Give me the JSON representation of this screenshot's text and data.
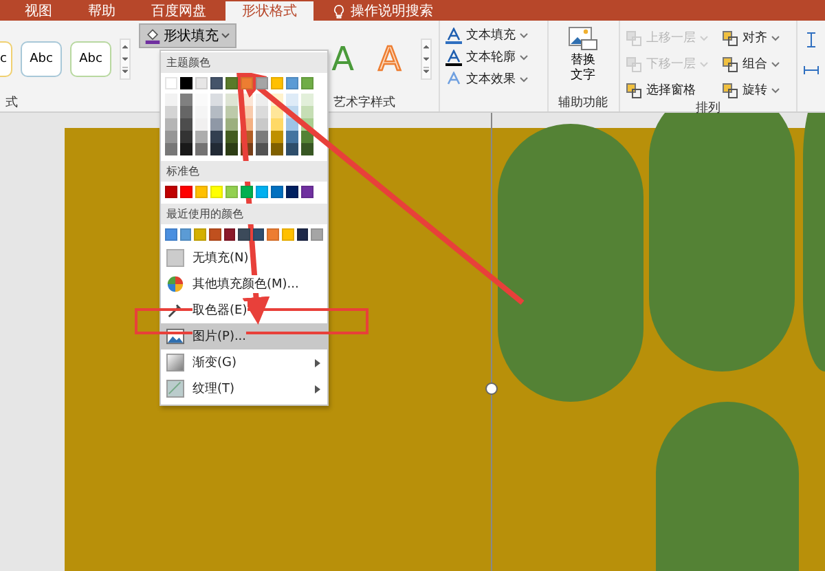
{
  "tabs": [
    {
      "label": "视图",
      "selected": false
    },
    {
      "label": "帮助",
      "selected": false
    },
    {
      "label": "百度网盘",
      "selected": false
    },
    {
      "label": "形状格式",
      "selected": true
    },
    {
      "label": "操作说明搜索",
      "selected": false,
      "kind": "search"
    }
  ],
  "ribbon": {
    "shape_styles": {
      "samples": [
        "c",
        "Abc",
        "Abc"
      ],
      "group_label": "式"
    },
    "shape_fill": {
      "label": "形状填充",
      "expanded": true
    },
    "wordart": {
      "samples": [
        {
          "kind": "green",
          "text": "A"
        },
        {
          "kind": "outline",
          "text": "A"
        }
      ],
      "group_label": "艺术字样式"
    },
    "text_buttons": [
      {
        "kind": "fill",
        "label": "文本填充"
      },
      {
        "kind": "outline",
        "label": "文本轮廓"
      },
      {
        "kind": "effect",
        "label": "文本效果"
      }
    ],
    "alt_text": {
      "label_line1": "替换",
      "label_line2": "文字",
      "group_label": "辅助功能"
    },
    "arrange": {
      "items": [
        {
          "kind": "up",
          "label": "上移一层",
          "disabled": true
        },
        {
          "kind": "align",
          "label": "对齐",
          "disabled": false
        },
        {
          "kind": "down",
          "label": "下移一层",
          "disabled": true
        },
        {
          "kind": "group",
          "label": "组合",
          "disabled": false
        },
        {
          "kind": "pane",
          "label": "选择窗格",
          "disabled": false
        },
        {
          "kind": "rotate",
          "label": "旋转",
          "disabled": false
        }
      ],
      "group_label": "排列"
    }
  },
  "menu": {
    "theme_heading": "主题颜色",
    "theme_colors": [
      {
        "color": "#ffffff"
      },
      {
        "color": "#000000"
      },
      {
        "color": "#e7e6e6"
      },
      {
        "color": "#44546a"
      },
      {
        "color": "#5a7a2a"
      },
      {
        "color": "#ed7d31"
      },
      {
        "color": "#a5a5a5"
      },
      {
        "color": "#ffc000"
      },
      {
        "color": "#5b9bd5"
      },
      {
        "color": "#70ad47"
      }
    ],
    "standard_heading": "标准色",
    "standard_colors": [
      {
        "color": "#c00000"
      },
      {
        "color": "#ff0000"
      },
      {
        "color": "#ffc000"
      },
      {
        "color": "#ffff00"
      },
      {
        "color": "#92d050"
      },
      {
        "color": "#00b050"
      },
      {
        "color": "#00b0f0"
      },
      {
        "color": "#0070c0"
      },
      {
        "color": "#002060"
      },
      {
        "color": "#7030a0"
      }
    ],
    "recent_heading": "最近使用的颜色",
    "recent_colors": [
      {
        "color": "#4a8fe0"
      },
      {
        "color": "#5b9bd5"
      },
      {
        "color": "#d4b000"
      },
      {
        "color": "#c0501e"
      },
      {
        "color": "#8b1a2a"
      },
      {
        "color": "#3c4a5a"
      },
      {
        "color": "#2f4f6f"
      },
      {
        "color": "#ed7d31"
      },
      {
        "color": "#ffc000"
      },
      {
        "color": "#1f2a4a"
      },
      {
        "color": "#a5a5a5"
      }
    ],
    "items": [
      {
        "kind": "none",
        "label": "无填充(N)",
        "selected": false,
        "submenu": false
      },
      {
        "kind": "more",
        "label": "其他填充颜色(M)...",
        "selected": false,
        "submenu": false
      },
      {
        "kind": "eyedropper",
        "label": "取色器(E)",
        "selected": false,
        "submenu": false
      },
      {
        "kind": "picture",
        "label": "图片(P)...",
        "selected": true,
        "submenu": false
      },
      {
        "kind": "gradient",
        "label": "渐变(G)",
        "selected": false,
        "submenu": true
      },
      {
        "kind": "texture",
        "label": "纹理(T)",
        "selected": false,
        "submenu": true
      }
    ]
  }
}
